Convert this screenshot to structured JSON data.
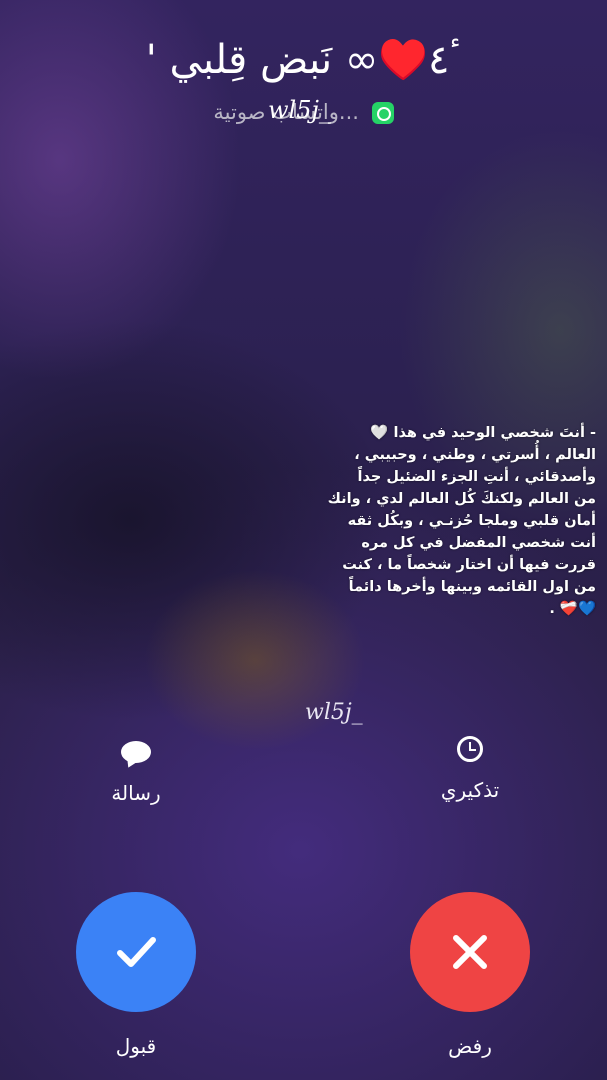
{
  "caller": {
    "name": "ٴ٤♥️∞ نَبض قِلبي '",
    "subtitle": "واتساب صوتية...",
    "watermark": "wl5j_"
  },
  "quote": {
    "lines": [
      "- أنتَ شخصي الوحيد في هذا 🤍",
      "العالم ، أُسرتي ، وطني ، وحبيبي ،",
      "وأصدقائي ، أنتِ الجزء الضئيل جداً",
      "من العالم ولكنكَ كُل العالم لدي ، وانك",
      "أمان قلبي وملجا حُزنـي ، وبكُل ثقه",
      "أنت شخصي المفضل في كل مره",
      "قررت فيها أن اختار شخصاً ما ، كنت",
      "من اول القائمه وبينها وأخرها دائماً",
      "💙❤️‍🩹 ."
    ],
    "watermark": "wl5j_"
  },
  "actions": {
    "remind_label": "تذكيري",
    "message_label": "رسالة"
  },
  "call": {
    "decline_label": "رفض",
    "accept_label": "قبول",
    "decline_color": "#ef4444",
    "accept_color": "#3b82f6"
  },
  "icons": {
    "whatsapp": "whatsapp-icon",
    "alarm": "alarm-clock-icon",
    "message": "message-bubble-icon",
    "accept": "checkmark-icon",
    "decline": "x-icon"
  }
}
